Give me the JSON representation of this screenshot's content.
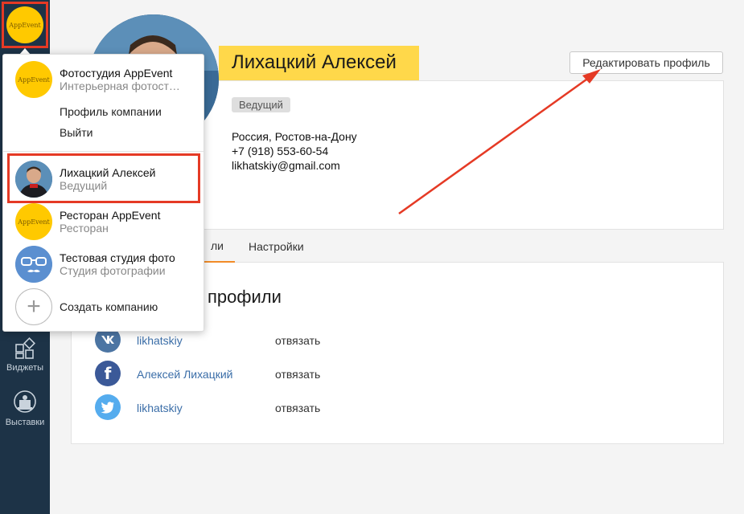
{
  "sidebar": {
    "logo_text": "AppEvent",
    "items": [
      {
        "label": "Виджеты",
        "icon": "widgets-icon"
      },
      {
        "label": "Выставки",
        "icon": "exhibition-icon"
      }
    ]
  },
  "profile": {
    "name": "Лихацкий Алексей",
    "role": "Ведущий",
    "location": "Россия, Ростов-на-Дону",
    "phone": "+7 (918) 553-60-54",
    "email": "likhatskiy@gmail.com",
    "edit_label": "Редактировать профиль"
  },
  "tabs": [
    {
      "label": "ли",
      "active": true
    },
    {
      "label": "Настройки",
      "active": false
    }
  ],
  "social": {
    "title": "профили",
    "unlink_label": "отвязать",
    "items": [
      {
        "network": "vk",
        "name": "likhatskiy",
        "color": "#4c75a3"
      },
      {
        "network": "facebook",
        "name": "Алексей Лихацкий",
        "color": "#3b5998"
      },
      {
        "network": "twitter",
        "name": "likhatskiy",
        "color": "#55acee"
      }
    ]
  },
  "dropdown": {
    "current_company": {
      "title": "Фотостудия AppEvent",
      "subtitle": "Интерьерная фотост…",
      "logo_text": "AppEvent"
    },
    "company_profile_label": "Профиль компании",
    "logout_label": "Выйти",
    "accounts": [
      {
        "title": "Лихацкий Алексей",
        "subtitle": "Ведущий",
        "avatar": "photo"
      },
      {
        "title": "Ресторан AppEvent",
        "subtitle": "Ресторан",
        "avatar": "logo",
        "logo_text": "AppEvent"
      },
      {
        "title": "Тестовая студия фото",
        "subtitle": "Студия фотографии",
        "avatar": "glasses"
      }
    ],
    "create_label": "Создать компанию"
  },
  "colors": {
    "sidebar": "#1d3347",
    "accent_yellow": "#ffd84a",
    "highlight_red": "#e53a25",
    "tab_active": "#f28c28",
    "link_blue": "#3b6ea8"
  }
}
